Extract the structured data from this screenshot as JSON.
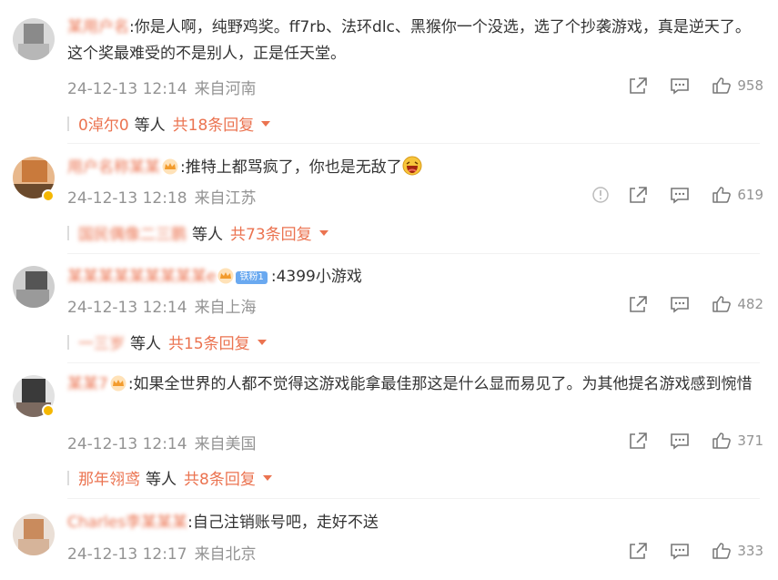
{
  "comments": [
    {
      "username": "某用户名",
      "text": ":你是人啊，纯野鸡奖。ff7rb、法环dlc、黑猴你一个没选，选了个抄袭游戏，真是逆天了。这个奖最难受的不是别人，正是任天堂。",
      "time": "24-12-13 12:14",
      "location": "来自河南",
      "likes": "958",
      "reply": {
        "who": "0淖尔0",
        "etc": "等人",
        "total": "共18条回复"
      }
    },
    {
      "username": "用户名称某某",
      "text": ":推特上都骂疯了，你也是无敌了",
      "time": "24-12-13 12:18",
      "location": "来自江苏",
      "likes": "619",
      "reply": {
        "who": "国民偶像二三鹏",
        "etc": "等人",
        "total": "共73条回复"
      }
    },
    {
      "username": "某某某某某某某某某e",
      "fan_badge": "铁粉1",
      "text": ":4399小游戏",
      "time": "24-12-13 12:14",
      "location": "来自上海",
      "likes": "482",
      "reply": {
        "who": "一三岁",
        "etc": "等人",
        "total": "共15条回复"
      }
    },
    {
      "username": "某某7",
      "text": ":如果全世界的人都不觉得这游戏能拿最佳那这是什么显而易见了。为其他提名游戏感到惋惜",
      "time": "24-12-13 12:14",
      "location": "来自美国",
      "likes": "371",
      "reply": {
        "who": "那年翎鸢",
        "etc": "等人",
        "total": "共8条回复"
      }
    },
    {
      "username": "Charles李某某某",
      "text": ":自己注销账号吧，走好不送",
      "time": "24-12-13 12:17",
      "location": "来自北京",
      "likes": "333"
    }
  ],
  "icons": {
    "share": "share-icon",
    "comment": "comment-icon",
    "like": "thumbs-up-icon",
    "report": "info-icon",
    "crown": "crown-icon",
    "expand": "chevron-down-icon"
  },
  "colors": {
    "accent": "#eb7350",
    "meta": "#939393",
    "text": "#333333"
  }
}
